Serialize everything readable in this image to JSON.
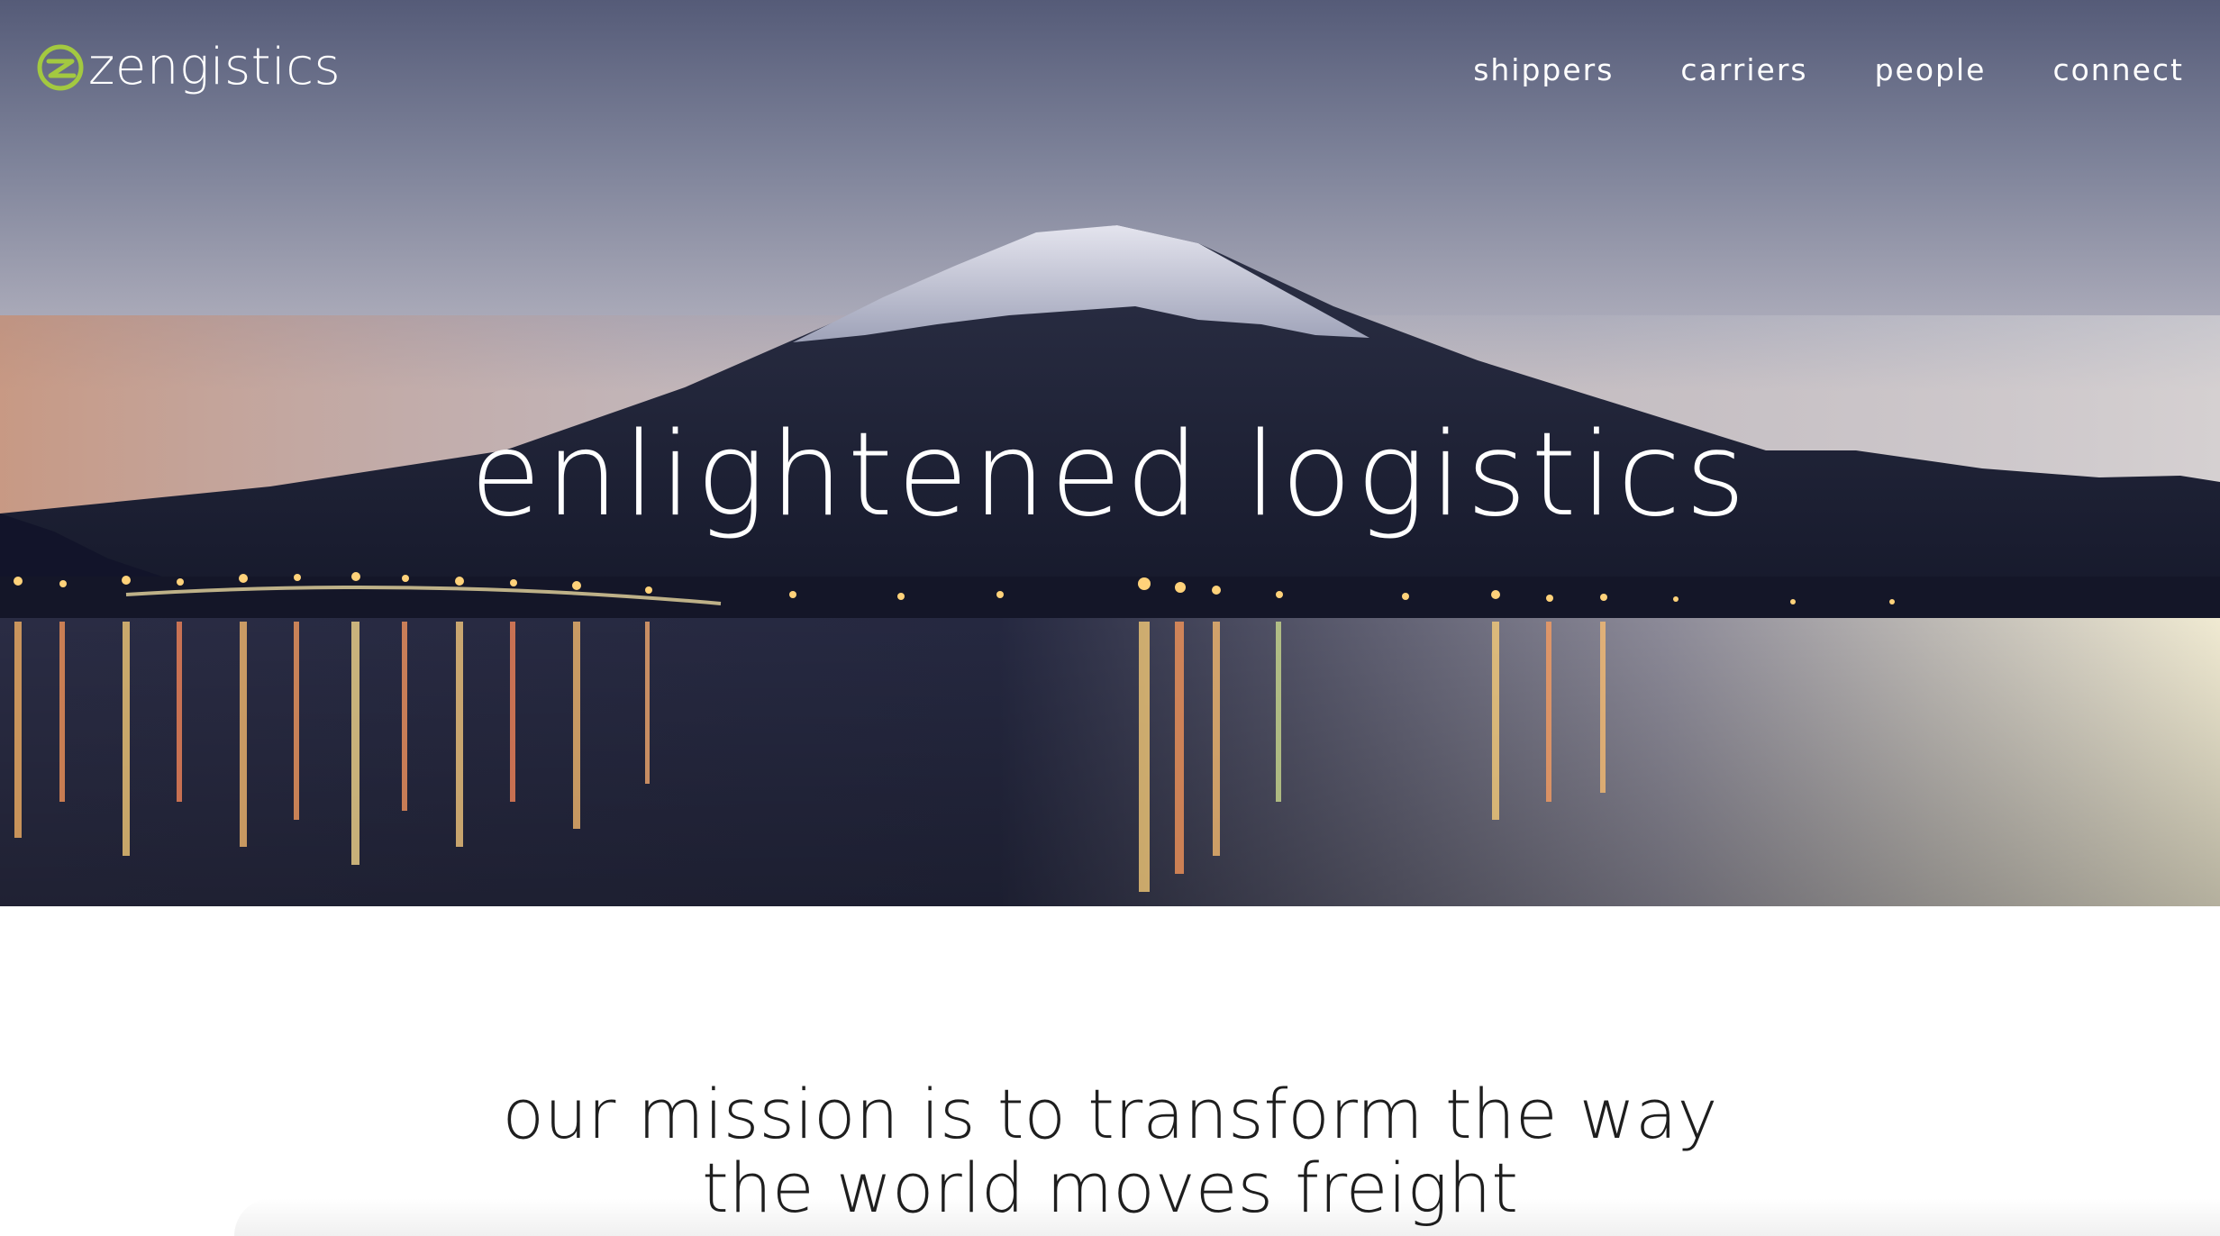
{
  "brand": {
    "name": "zengistics",
    "logo_icon": "zen-circle-z-icon",
    "accent_color": "#a3c940"
  },
  "nav": {
    "items": [
      {
        "label": "shippers"
      },
      {
        "label": "carriers"
      },
      {
        "label": "people"
      },
      {
        "label": "connect"
      }
    ]
  },
  "hero": {
    "title": "enlightened logistics"
  },
  "mission": {
    "line1": "our mission is to transform the way",
    "line2": "the world moves freight"
  }
}
